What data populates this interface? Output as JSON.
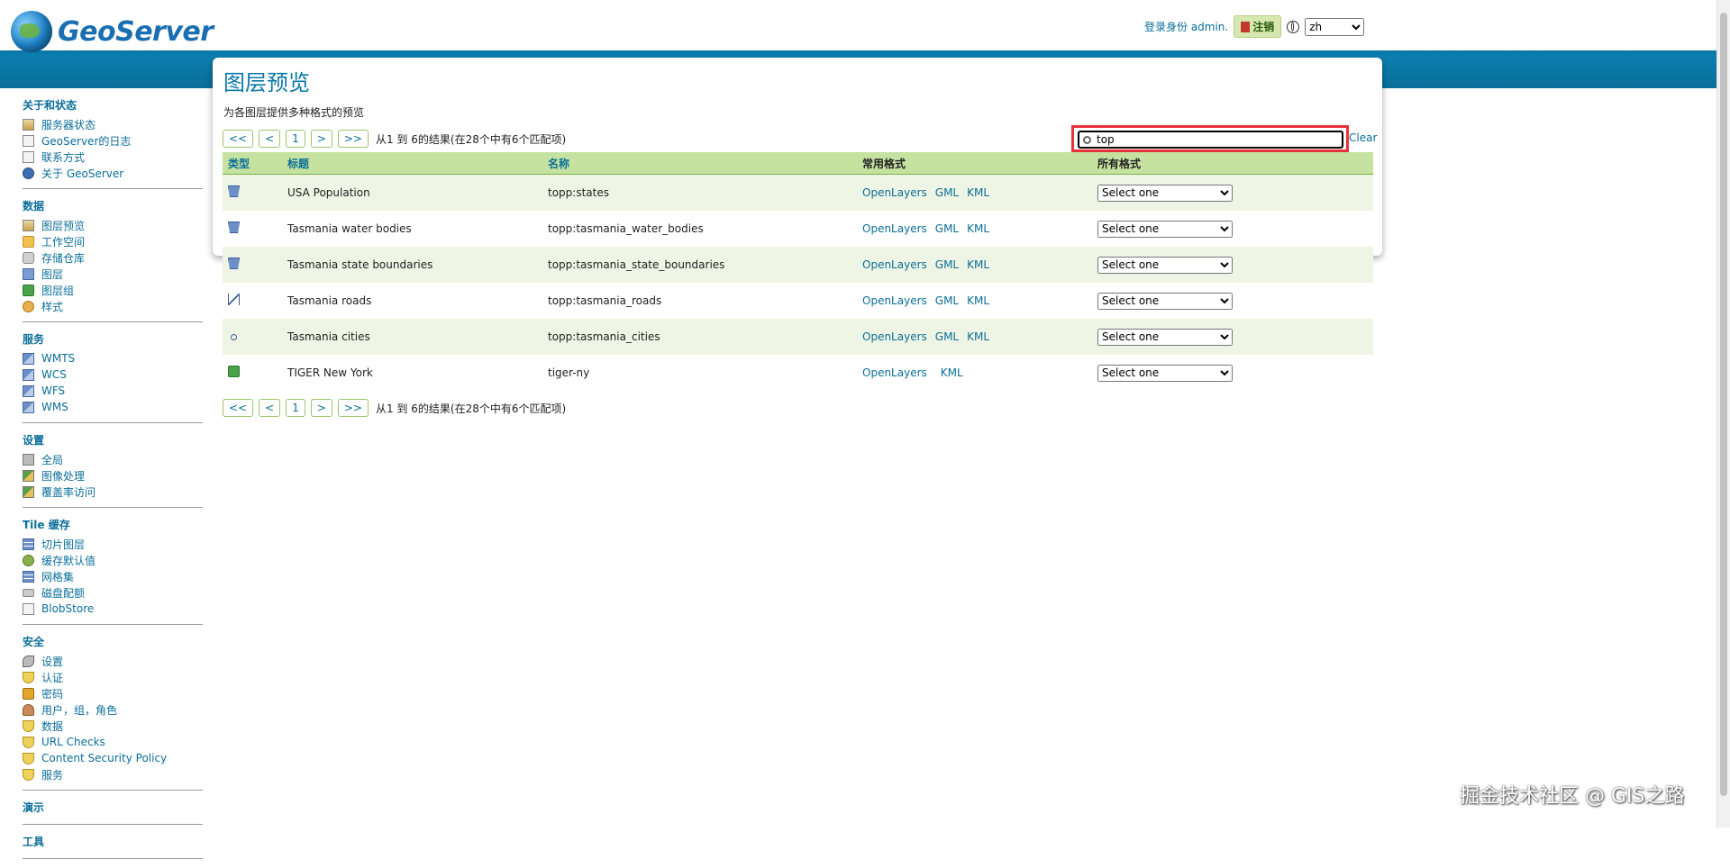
{
  "header": {
    "app_name": "GeoServer",
    "login_text": "登录身份 admin.",
    "logout_label": "注销",
    "language": "zh",
    "language_options": [
      "zh"
    ]
  },
  "sidebar": {
    "sections": [
      {
        "title": "关于和状态",
        "items": [
          {
            "label": "服务器状态",
            "icon": "chart-icon"
          },
          {
            "label": "GeoServer的日志",
            "icon": "document-icon"
          },
          {
            "label": "联系方式",
            "icon": "document-icon"
          },
          {
            "label": "关于 GeoServer",
            "icon": "info-icon"
          }
        ]
      },
      {
        "title": "数据",
        "items": [
          {
            "label": "图层预览",
            "icon": "map-preview-icon"
          },
          {
            "label": "工作空间",
            "icon": "folder-icon"
          },
          {
            "label": "存储仓库",
            "icon": "database-icon"
          },
          {
            "label": "图层",
            "icon": "layer-icon"
          },
          {
            "label": "图层组",
            "icon": "layer-group-icon"
          },
          {
            "label": "样式",
            "icon": "palette-icon"
          }
        ]
      },
      {
        "title": "服务",
        "items": [
          {
            "label": "WMTS",
            "icon": "service-icon"
          },
          {
            "label": "WCS",
            "icon": "service-icon"
          },
          {
            "label": "WFS",
            "icon": "service-icon"
          },
          {
            "label": "WMS",
            "icon": "service-icon"
          }
        ]
      },
      {
        "title": "设置",
        "items": [
          {
            "label": "全局",
            "icon": "server-icon"
          },
          {
            "label": "图像处理",
            "icon": "image-icon"
          },
          {
            "label": "覆盖率访问",
            "icon": "image-icon"
          }
        ]
      },
      {
        "title": "Tile 缓存",
        "items": [
          {
            "label": "切片图层",
            "icon": "tile-layer-icon"
          },
          {
            "label": "缓存默认值",
            "icon": "gear-icon"
          },
          {
            "label": "网格集",
            "icon": "grid-icon"
          },
          {
            "label": "磁盘配额",
            "icon": "disk-icon"
          },
          {
            "label": "BlobStore",
            "icon": "document-icon"
          }
        ]
      },
      {
        "title": "安全",
        "items": [
          {
            "label": "设置",
            "icon": "key-icon"
          },
          {
            "label": "认证",
            "icon": "shield-icon"
          },
          {
            "label": "密码",
            "icon": "lock-icon"
          },
          {
            "label": "用户，组，角色",
            "icon": "users-icon"
          },
          {
            "label": "数据",
            "icon": "shield-icon"
          },
          {
            "label": "URL Checks",
            "icon": "shield-icon"
          },
          {
            "label": "Content Security Policy",
            "icon": "shield-icon"
          },
          {
            "label": "服务",
            "icon": "shield-icon"
          }
        ]
      },
      {
        "title": "演示",
        "items": []
      },
      {
        "title": "工具",
        "items": []
      }
    ]
  },
  "main": {
    "title": "图层预览",
    "description": "为各图层提供多种格式的预览",
    "pager": {
      "first": "<<",
      "prev": "<",
      "page": "1",
      "next": ">",
      "last": ">>",
      "info": "从1 到 6的结果(在28个中有6个匹配项)"
    },
    "search": {
      "value": "top",
      "clear_label": "Clear"
    },
    "table": {
      "headers": {
        "type": "类型",
        "title": "标题",
        "name": "名称",
        "common": "常用格式",
        "all": "所有格式"
      },
      "rows": [
        {
          "type": "polygon",
          "title": "USA Population",
          "name": "topp:states",
          "formats": [
            "OpenLayers",
            "GML",
            "KML"
          ],
          "select": "Select one"
        },
        {
          "type": "polygon",
          "title": "Tasmania water bodies",
          "name": "topp:tasmania_water_bodies",
          "formats": [
            "OpenLayers",
            "GML",
            "KML"
          ],
          "select": "Select one"
        },
        {
          "type": "polygon",
          "title": "Tasmania state boundaries",
          "name": "topp:tasmania_state_boundaries",
          "formats": [
            "OpenLayers",
            "GML",
            "KML"
          ],
          "select": "Select one"
        },
        {
          "type": "line",
          "title": "Tasmania roads",
          "name": "topp:tasmania_roads",
          "formats": [
            "OpenLayers",
            "GML",
            "KML"
          ],
          "select": "Select one"
        },
        {
          "type": "point",
          "title": "Tasmania cities",
          "name": "topp:tasmania_cities",
          "formats": [
            "OpenLayers",
            "GML",
            "KML"
          ],
          "select": "Select one"
        },
        {
          "type": "group",
          "title": "TIGER New York",
          "name": "tiger-ny",
          "formats": [
            "OpenLayers",
            "KML"
          ],
          "select": "Select one"
        }
      ]
    }
  },
  "watermark": "掘金技术社区 @ GIS之路",
  "colors": {
    "accent": "#0a79a8",
    "header_row": "#c6e2a0",
    "alt_row": "#eef5e4",
    "highlight": "#e8313a"
  }
}
